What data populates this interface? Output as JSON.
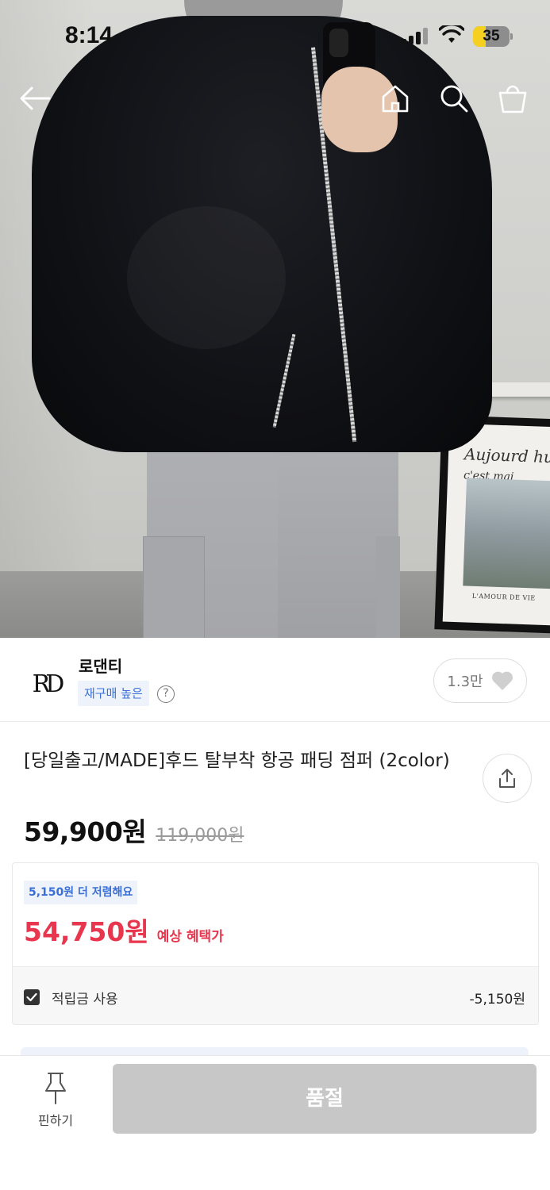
{
  "status_bar": {
    "time": "8:14",
    "battery_level": 0.35,
    "battery_text": "35"
  },
  "nav": {
    "back_icon": "arrow-left-icon",
    "home_icon": "home-icon",
    "search_icon": "search-icon",
    "cart_icon": "shopping-bag-icon"
  },
  "hero": {
    "frame_script": "Aujourd hu",
    "frame_script2": "c'est mai",
    "frame_caption": "L'AMOUR DE VIE"
  },
  "seller": {
    "logo_text": "RD",
    "name": "로댄티",
    "badge": "재구매 높은",
    "help": "?",
    "like_count": "1.3만"
  },
  "product": {
    "title": "[당일출고/MADE]후드 탈부착 항공 패딩 점퍼 (2color)",
    "price": "59,900원",
    "original_price": "119,000원"
  },
  "discount": {
    "save_badge": "5,150원 더 저렴해요",
    "expected_price": "54,750원",
    "expected_label": "예상 혜택가",
    "points_label": "적립금 사용",
    "points_value": "-5,150원",
    "points_checked": true
  },
  "bottom_bar": {
    "pin_label": "핀하기",
    "soldout_label": "품절"
  },
  "colors": {
    "accent_red": "#e8364f",
    "accent_blue": "#3a6fd8",
    "disabled_button": "#c7c7c7"
  }
}
